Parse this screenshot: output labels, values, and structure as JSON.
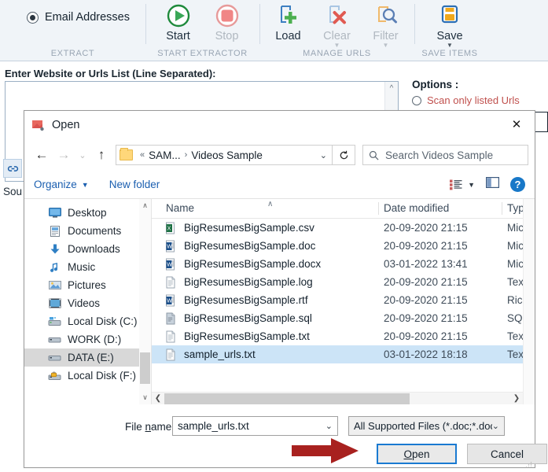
{
  "app": {
    "extract": {
      "group_label": "EXTRACT",
      "option_label": "Email Addresses",
      "option_icon": "radio-selected-icon"
    },
    "start_extractor": {
      "group_label": "START EXTRACTOR",
      "buttons": [
        {
          "label": "Start",
          "icon": "play-circle-icon",
          "enabled": true
        },
        {
          "label": "Stop",
          "icon": "stop-circle-icon",
          "enabled": false
        }
      ]
    },
    "manage_urls": {
      "group_label": "MANAGE URLS",
      "buttons": [
        {
          "label": "Load",
          "icon": "document-plus-icon",
          "enabled": true
        },
        {
          "label": "Clear",
          "icon": "document-x-icon",
          "enabled": false
        },
        {
          "label": "Filter",
          "icon": "document-search-icon",
          "enabled": false
        }
      ]
    },
    "save_items": {
      "group_label": "SAVE ITEMS",
      "buttons": [
        {
          "label": "Save",
          "icon": "save-disk-icon",
          "enabled": true
        }
      ]
    },
    "urls_label": "Enter Website or Urls List (Line Separated):",
    "urls_value": "",
    "options_title": "Options :",
    "scan_only_label": "Scan only listed Urls",
    "link_icon": "link-icon",
    "source_text": "Sou"
  },
  "dialog": {
    "title": "Open",
    "title_icon": "app-red-icon",
    "close_icon": "close-icon",
    "nav": {
      "back_icon": "arrow-left-icon",
      "forward_icon": "arrow-right-icon",
      "history_icon": "chevron-down-icon",
      "up_icon": "arrow-up-icon",
      "folder_icon": "folder-icon",
      "crumb_overflow": "«",
      "crumb_parent": "SAM...",
      "crumb_sep": "›",
      "crumb_current": "Videos Sample",
      "crumb_caret_icon": "chevron-down-icon",
      "refresh_icon": "refresh-icon",
      "search_icon": "search-icon",
      "search_placeholder": "Search Videos Sample"
    },
    "toolbar": {
      "organize_label": "Organize",
      "organize_caret_icon": "caret-down-icon",
      "new_folder_label": "New folder",
      "view_icon": "view-list-icon",
      "view_caret_icon": "caret-down-icon",
      "preview_pane_icon": "preview-pane-icon",
      "help_icon": "help-icon",
      "help_label": "?"
    },
    "nav_pane": {
      "items": [
        {
          "label": "Desktop",
          "icon": "desktop-icon",
          "selected": false
        },
        {
          "label": "Documents",
          "icon": "documents-icon",
          "selected": false
        },
        {
          "label": "Downloads",
          "icon": "downloads-icon",
          "selected": false
        },
        {
          "label": "Music",
          "icon": "music-icon",
          "selected": false
        },
        {
          "label": "Pictures",
          "icon": "pictures-icon",
          "selected": false
        },
        {
          "label": "Videos",
          "icon": "videos-icon",
          "selected": false
        },
        {
          "label": "Local Disk (C:)",
          "icon": "system-drive-icon",
          "selected": false
        },
        {
          "label": "WORK (D:)",
          "icon": "drive-icon",
          "selected": false
        },
        {
          "label": "DATA (E:)",
          "icon": "drive-icon",
          "selected": true
        },
        {
          "label": "Local Disk (F:)",
          "icon": "locked-drive-icon",
          "selected": false
        }
      ],
      "scroll_up_icon": "chevron-up-icon",
      "scroll_down_icon": "chevron-down-icon"
    },
    "file_list": {
      "columns": [
        "Name",
        "Date modified",
        "Type"
      ],
      "sort_indicator_icon": "sort-ascending-icon",
      "rows": [
        {
          "name": "BigResumesBigSample.csv",
          "date": "20-09-2020 21:15",
          "type": "Micro",
          "icon": "excel-file-icon",
          "selected": false
        },
        {
          "name": "BigResumesBigSample.doc",
          "date": "20-09-2020 21:15",
          "type": "Micro",
          "icon": "word-file-icon",
          "selected": false
        },
        {
          "name": "BigResumesBigSample.docx",
          "date": "03-01-2022 13:41",
          "type": "Micro",
          "icon": "word-file-icon",
          "selected": false
        },
        {
          "name": "BigResumesBigSample.log",
          "date": "20-09-2020 21:15",
          "type": "Text ",
          "icon": "text-file-icon",
          "selected": false
        },
        {
          "name": "BigResumesBigSample.rtf",
          "date": "20-09-2020 21:15",
          "type": "Rich ",
          "icon": "word-file-icon",
          "selected": false
        },
        {
          "name": "BigResumesBigSample.sql",
          "date": "20-09-2020 21:15",
          "type": "SQL ",
          "icon": "sql-file-icon",
          "selected": false
        },
        {
          "name": "BigResumesBigSample.txt",
          "date": "20-09-2020 21:15",
          "type": "Text ",
          "icon": "text-file-icon",
          "selected": false
        },
        {
          "name": "sample_urls.txt",
          "date": "03-01-2022 18:18",
          "type": "Text ",
          "icon": "text-file-icon",
          "selected": true
        }
      ],
      "hscroll_left_icon": "chevron-left-icon",
      "hscroll_right_icon": "chevron-right-icon"
    },
    "bottom": {
      "file_name_label": "File name:",
      "file_name_label_prefix": "File ",
      "file_name_label_mnemonic": "n",
      "file_name_label_suffix": "ame:",
      "file_name_value": "sample_urls.txt",
      "file_name_caret_icon": "chevron-down-icon",
      "filter_value": "All Supported Files  (*.doc;*.doc",
      "filter_caret_icon": "chevron-down-icon",
      "open_label": "Open",
      "open_mnemonic": "O",
      "open_rest": "pen",
      "cancel_label": "Cancel",
      "resize_grip_icon": "resize-grip-icon"
    }
  },
  "annotation": {
    "arrow_icon": "red-arrow-right-icon",
    "arrow_color": "#a8211f"
  },
  "colors": {
    "accent_blue": "#1a7ad1",
    "selection_blue": "#cce4f7",
    "ribbon_bg": "#f0f4f8",
    "red_text": "#c0504d"
  }
}
